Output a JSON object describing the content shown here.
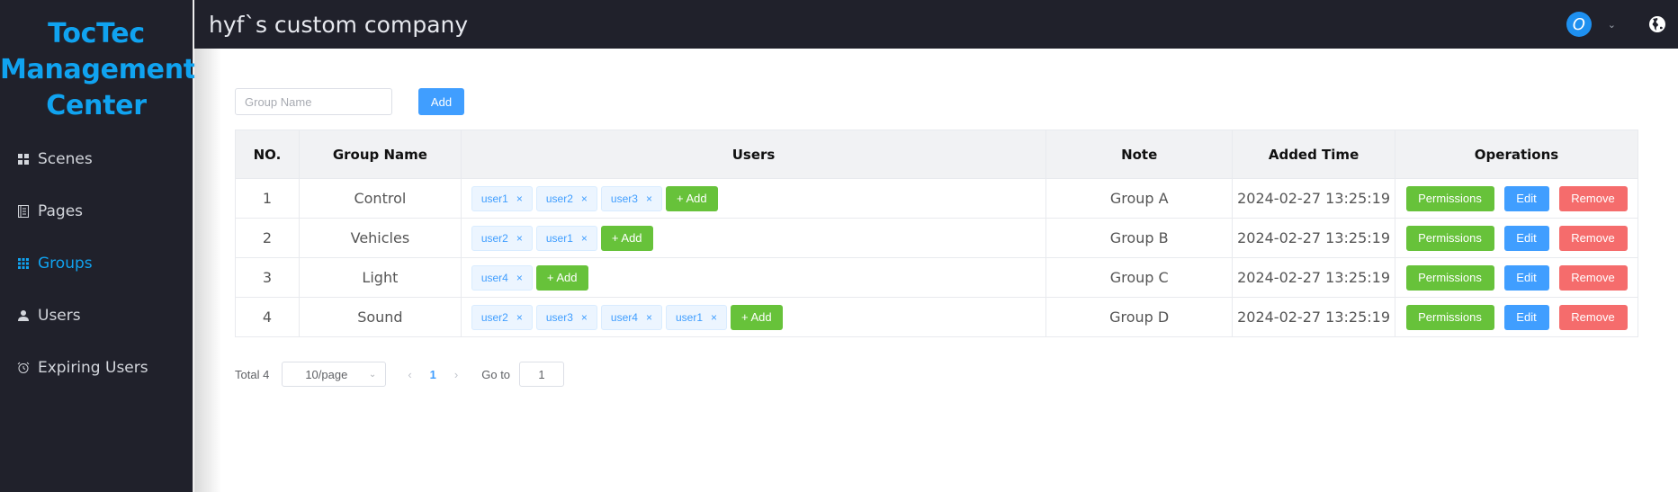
{
  "sidebar": {
    "brand_lines": [
      "TocTec",
      "Management",
      "Center"
    ],
    "items": [
      {
        "label": "Scenes",
        "icon": "grid-icon",
        "active": false
      },
      {
        "label": "Pages",
        "icon": "document-icon",
        "active": false
      },
      {
        "label": "Groups",
        "icon": "apps-icon",
        "active": true
      },
      {
        "label": "Users",
        "icon": "user-icon",
        "active": false
      },
      {
        "label": "Expiring Users",
        "icon": "alarm-clock-icon",
        "active": false
      }
    ]
  },
  "header": {
    "company": "hyf`s custom company",
    "avatar_letter": "O",
    "icons": [
      "avatar",
      "chevron-down-icon",
      "globe-icon"
    ]
  },
  "toolbar": {
    "group_name_placeholder": "Group Name",
    "group_name_value": "",
    "add_label": "Add"
  },
  "table": {
    "columns": [
      "NO.",
      "Group Name",
      "Users",
      "Note",
      "Added Time",
      "Operations"
    ],
    "rows": [
      {
        "no": "1",
        "name": "Control",
        "users": [
          "user1",
          "user2",
          "user3"
        ],
        "note": "Group A",
        "added": "2024-02-27 13:25:19"
      },
      {
        "no": "2",
        "name": "Vehicles",
        "users": [
          "user2",
          "user1"
        ],
        "note": "Group B",
        "added": "2024-02-27 13:25:19"
      },
      {
        "no": "3",
        "name": "Light",
        "users": [
          "user4"
        ],
        "note": "Group C",
        "added": "2024-02-27 13:25:19"
      },
      {
        "no": "4",
        "name": "Sound",
        "users": [
          "user2",
          "user3",
          "user4",
          "user1"
        ],
        "note": "Group D",
        "added": "2024-02-27 13:25:19"
      }
    ],
    "add_user_label": "+ Add",
    "tag_close_glyph": "×",
    "ops": {
      "permissions": "Permissions",
      "edit": "Edit",
      "remove": "Remove"
    }
  },
  "pagination": {
    "total": "Total 4",
    "page_size": "10/page",
    "prev": "‹",
    "current": "1",
    "next": "›",
    "goto_label": "Go to",
    "goto_value": "1"
  },
  "colors": {
    "brand": "#10a3f0",
    "primary": "#409eff",
    "success": "#67c23a",
    "danger": "#f56c6c",
    "dark_bg": "#20212b"
  }
}
